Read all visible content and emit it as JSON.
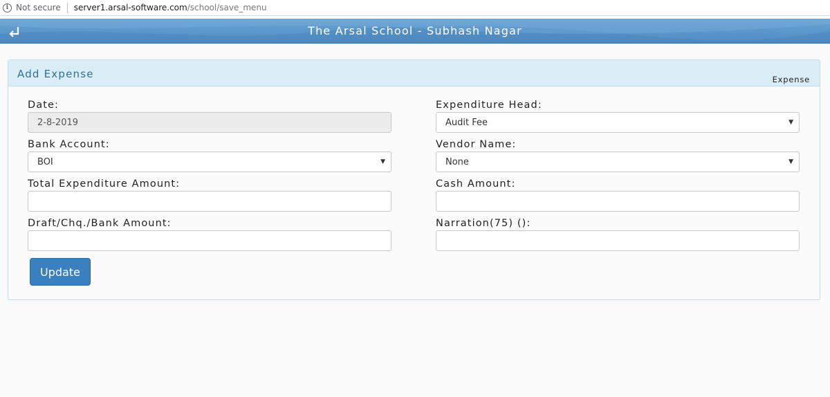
{
  "browser": {
    "security_label": "Not secure",
    "url_host": "server1.arsal-software.com",
    "url_path": "/school/save_menu"
  },
  "header": {
    "title": "The Arsal School - Subhash Nagar",
    "back_icon": "return-arrow-icon"
  },
  "panel": {
    "title": "Add Expense",
    "tag": "Expense"
  },
  "form": {
    "date": {
      "label": "Date:",
      "value": "2-8-2019"
    },
    "expenditure_head": {
      "label": "Expenditure Head:",
      "value": "Audit Fee"
    },
    "bank_account": {
      "label": "Bank Account:",
      "value": "BOI"
    },
    "vendor_name": {
      "label": "Vendor Name:",
      "value": "None"
    },
    "total_expenditure": {
      "label": "Total Expenditure Amount:",
      "value": ""
    },
    "cash_amount": {
      "label": "Cash Amount:",
      "value": ""
    },
    "draft_amount": {
      "label": "Draft/Chq./Bank Amount:",
      "value": ""
    },
    "narration": {
      "label": "Narration(75) ():",
      "value": ""
    },
    "submit_label": "Update"
  },
  "colors": {
    "header_blue": "#5f9acd",
    "panel_heading": "#d9edf7",
    "button_blue": "#3a7fbf"
  }
}
